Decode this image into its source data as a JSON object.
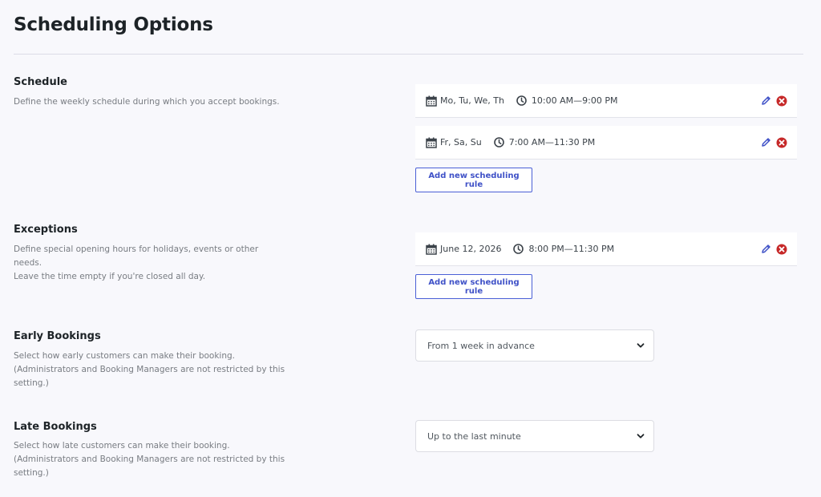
{
  "page": {
    "title": "Scheduling Options"
  },
  "schedule": {
    "title": "Schedule",
    "description": "Define the weekly schedule during which you accept bookings.",
    "rules": [
      {
        "days": "Mo, Tu, We, Th",
        "time": "10:00 AM—9:00 PM"
      },
      {
        "days": "Fr, Sa, Su",
        "time": "7:00 AM—11:30 PM"
      }
    ],
    "add_label": "Add new scheduling rule"
  },
  "exceptions": {
    "title": "Exceptions",
    "description_lines": [
      "Define special opening hours for holidays, events or other needs.",
      "Leave the time empty if you're closed all day."
    ],
    "rules": [
      {
        "days": "June 12, 2026",
        "time": "8:00 PM—11:30 PM"
      }
    ],
    "add_label": "Add new scheduling rule"
  },
  "early_bookings": {
    "title": "Early Bookings",
    "description_lines": [
      "Select how early customers can make their booking.",
      "(Administrators and Booking Managers are not restricted by this",
      "setting.)"
    ],
    "selected": "From 1 week in advance"
  },
  "late_bookings": {
    "title": "Late Bookings",
    "description_lines": [
      "Select how late customers can make their booking.",
      "(Administrators and Booking Managers are not restricted by this",
      "setting.)"
    ],
    "selected": "Up to the last minute"
  },
  "colors": {
    "background": "#f8f8fc",
    "accent": "#3f51c7",
    "delete": "#c62828",
    "icon": "#3c434a"
  },
  "icons": [
    "calendar-icon",
    "clock-icon",
    "edit-pencil-icon",
    "delete-x-icon",
    "chevron-down-icon"
  ]
}
